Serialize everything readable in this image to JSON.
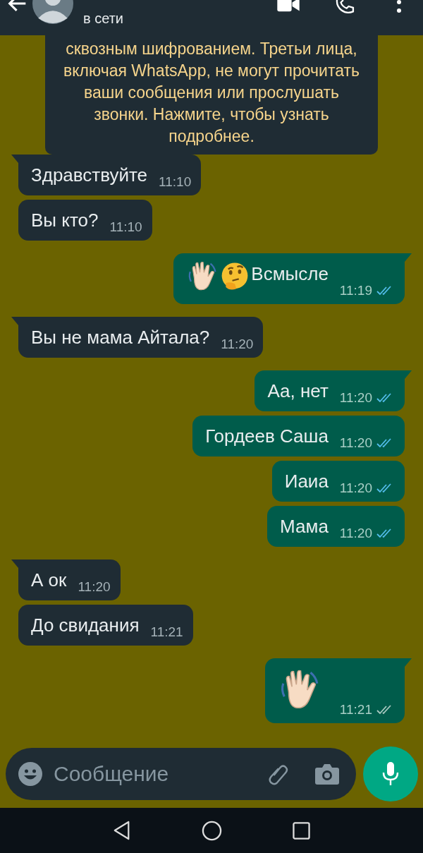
{
  "header": {
    "status": "в сети"
  },
  "notice": "сквозным шифрованием. Третьи лица, включая WhatsApp, не могут прочитать ваши сообщения или прослушать звонки. Нажмите, чтобы узнать подробнее.",
  "messages": [
    {
      "outgoing": false,
      "text": "Здравствуйте",
      "time": "11:10"
    },
    {
      "outgoing": false,
      "text": "Вы кто?",
      "time": "11:10"
    },
    {
      "outgoing": true,
      "icons": [
        {
          "kind": "wave"
        },
        {
          "kind": "thinking"
        }
      ],
      "text": "Всмысле",
      "time": "11:19",
      "read": true
    },
    {
      "outgoing": false,
      "text": "Вы не мама Айтала?",
      "time": "11:20"
    },
    {
      "outgoing": true,
      "text": "Аа, нет",
      "time": "11:20",
      "read": true
    },
    {
      "outgoing": true,
      "text": "Гордеев Саша",
      "time": "11:20",
      "read": true
    },
    {
      "outgoing": true,
      "text": "Иаиа",
      "time": "11:20",
      "read": true
    },
    {
      "outgoing": true,
      "text": "Мама",
      "time": "11:20",
      "read": true
    },
    {
      "outgoing": false,
      "text": "А ок",
      "time": "11:20"
    },
    {
      "outgoing": false,
      "text": "До свидания",
      "time": "11:21"
    },
    {
      "outgoing": true,
      "icons": [
        {
          "kind": "wave"
        }
      ],
      "time": "11:21",
      "read": false
    }
  ],
  "composer": {
    "placeholder": "Сообщение"
  }
}
